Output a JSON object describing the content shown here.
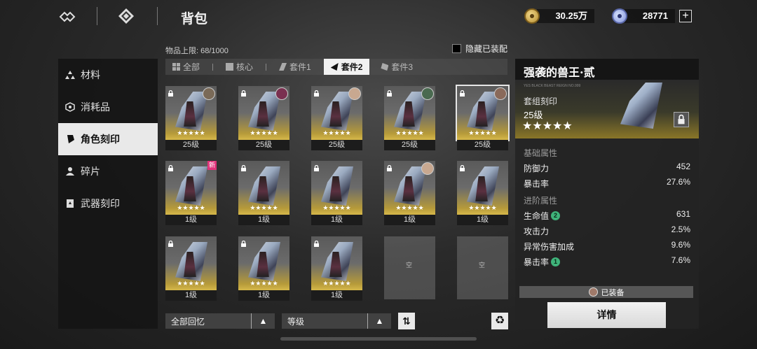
{
  "header": {
    "title": "背包"
  },
  "currency": [
    {
      "icon": "coin-icon",
      "value": "30.25万"
    },
    {
      "icon": "gem-icon",
      "value": "28771"
    }
  ],
  "plus_label": "+",
  "sidebar": {
    "items": [
      {
        "label": "材料",
        "icon": "triangle-cluster-icon"
      },
      {
        "label": "消耗品",
        "icon": "hexagon-icon"
      },
      {
        "label": "角色刻印",
        "icon": "shard-icon",
        "active": true
      },
      {
        "label": "碎片",
        "icon": "person-icon"
      },
      {
        "label": "武器刻印",
        "icon": "card-icon"
      }
    ]
  },
  "inventory": {
    "capacity": "物品上限: 68/1000",
    "hide_equipped": "隐藏已装配"
  },
  "tabs": [
    {
      "label": "全部"
    },
    {
      "label": "核心"
    },
    {
      "label": "套件1"
    },
    {
      "label": "套件2",
      "active": true
    },
    {
      "label": "套件3"
    }
  ],
  "cards": [
    {
      "level": "25级",
      "stars": "★★★★★",
      "locked": true,
      "avatar": true,
      "selected": false,
      "new": false
    },
    {
      "level": "25级",
      "stars": "★★★★★",
      "locked": true,
      "avatar": true,
      "selected": false,
      "new": false
    },
    {
      "level": "25级",
      "stars": "★★★★★",
      "locked": true,
      "avatar": true,
      "selected": false,
      "new": false
    },
    {
      "level": "25级",
      "stars": "★★★★★",
      "locked": true,
      "avatar": true,
      "selected": false,
      "new": false
    },
    {
      "level": "25级",
      "stars": "★★★★★",
      "locked": true,
      "avatar": true,
      "selected": true,
      "new": false
    },
    {
      "level": "1级",
      "stars": "★★★★★",
      "locked": true,
      "avatar": false,
      "selected": false,
      "new": true,
      "new_label": "新"
    },
    {
      "level": "1级",
      "stars": "★★★★★",
      "locked": true,
      "avatar": false,
      "selected": false,
      "new": false
    },
    {
      "level": "1级",
      "stars": "★★★★★",
      "locked": true,
      "avatar": false,
      "selected": false,
      "new": false
    },
    {
      "level": "1级",
      "stars": "★★★★★",
      "locked": true,
      "avatar": true,
      "selected": false,
      "new": false
    },
    {
      "level": "1级",
      "stars": "★★★★★",
      "locked": true,
      "avatar": false,
      "selected": false,
      "new": false
    },
    {
      "level": "1级",
      "stars": "★★★★★",
      "locked": true,
      "avatar": false,
      "selected": false,
      "new": false
    },
    {
      "level": "1级",
      "stars": "★★★★★",
      "locked": true,
      "avatar": false,
      "selected": false,
      "new": false
    },
    {
      "level": "1级",
      "stars": "★★★★★",
      "locked": true,
      "avatar": false,
      "selected": false,
      "new": false
    }
  ],
  "empty_slot_label": "空",
  "controls": {
    "filter_label": "全部回忆",
    "sort_label": "等级",
    "arrow": "▲",
    "sort_toggle": "⇅",
    "recycle": "♻"
  },
  "detail": {
    "name": "强袭的兽王·贰",
    "hero_small": "YES BLACK BEAST REIGN NO.999",
    "type": "套组刻印",
    "level": "25级",
    "stars": "★★★★★",
    "basic_title": "基础属性",
    "basic": [
      {
        "name": "防御力",
        "value": "452"
      },
      {
        "name": "暴击率",
        "value": "27.6%"
      }
    ],
    "advanced_title": "进阶属性",
    "advanced": [
      {
        "name": "生命值",
        "value": "631",
        "roll": "2"
      },
      {
        "name": "攻击力",
        "value": "2.5%",
        "roll": ""
      },
      {
        "name": "异常伤害加成",
        "value": "9.6%",
        "roll": ""
      },
      {
        "name": "暴击率",
        "value": "7.6%",
        "roll": "1"
      }
    ],
    "equipped_label": "已装备",
    "detail_button": "详情"
  },
  "colors": {
    "accent_gold": "#d6b84a",
    "roll_green": "#3fb37a",
    "new_pink": "#e0337a"
  }
}
